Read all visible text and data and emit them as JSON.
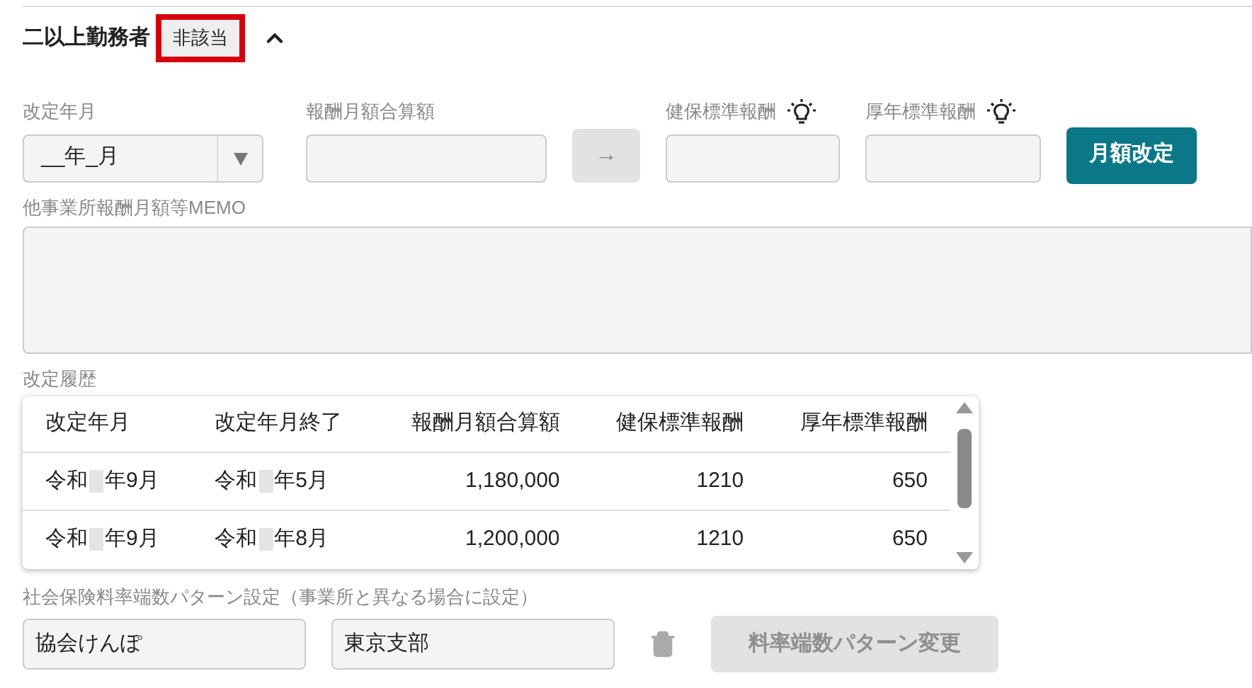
{
  "section": {
    "title": "二以上勤務者",
    "badge": "非該当",
    "badge_highlighted": true,
    "expanded": true
  },
  "revision": {
    "month_label": "改定年月",
    "month_value": "__年_月",
    "sum_label": "報酬月額合算額",
    "arrow": "→",
    "health_label": "健保標準報酬",
    "pension_label": "厚年標準報酬",
    "apply_button": "月額改定"
  },
  "memo": {
    "label": "他事業所報酬月額等MEMO"
  },
  "history": {
    "label": "改定履歴",
    "columns": [
      "改定年月",
      "改定年月終了",
      "報酬月額合算額",
      "健保標準報酬",
      "厚年標準報酬"
    ],
    "rows": [
      {
        "start": {
          "era": "令和",
          "rest": "年9月"
        },
        "end": {
          "era": "令和",
          "rest": "年5月"
        },
        "sum": "1,180,000",
        "health": "1210",
        "pension": "650"
      },
      {
        "start": {
          "era": "令和",
          "rest": "年9月"
        },
        "end": {
          "era": "令和",
          "rest": "年8月"
        },
        "sum": "1,200,000",
        "health": "1210",
        "pension": "650"
      }
    ]
  },
  "rounding": {
    "label": "社会保険料率端数パターン設定（事業所と異なる場合に設定）",
    "insurer": "協会けんぽ",
    "branch": "東京支部",
    "change_button": "料率端数パターン変更",
    "change_disabled": true
  }
}
